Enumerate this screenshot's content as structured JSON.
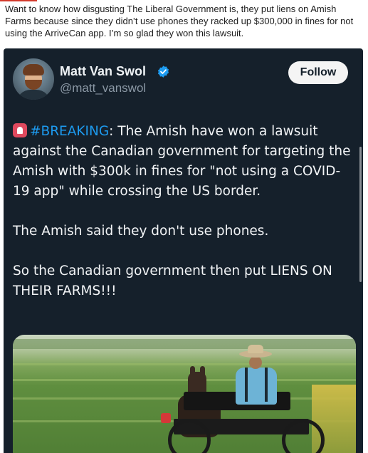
{
  "post": {
    "text": "Want to know how disgusting The Liberal Government is, they put liens on Amish Farms because since they didn’t use phones they racked up $300,000 in fines for not using the ArriveCan app. I’m so glad they won this lawsuit."
  },
  "tweet": {
    "author_name": "Matt Van Swol",
    "author_handle": "@matt_vanswol",
    "follow_label": "Follow",
    "siren_icon": "police-light-icon",
    "hashtag": "#BREAKING",
    "line1_rest": ": The Amish have won a lawsuit against the Canadian government for targeting the Amish with $300k in fines for \"not using a COVID-19 app\" while crossing the US border.",
    "paragraph2": "The Amish said they don't use phones.",
    "paragraph3": "So the Canadian government then put LIENS ON THEIR FARMS!!!"
  },
  "colors": {
    "embed_background": "#15202b",
    "link_blue": "#1d9bf0",
    "verified_blue": "#1d9bf0",
    "follow_button_bg": "#f4f4f4"
  }
}
